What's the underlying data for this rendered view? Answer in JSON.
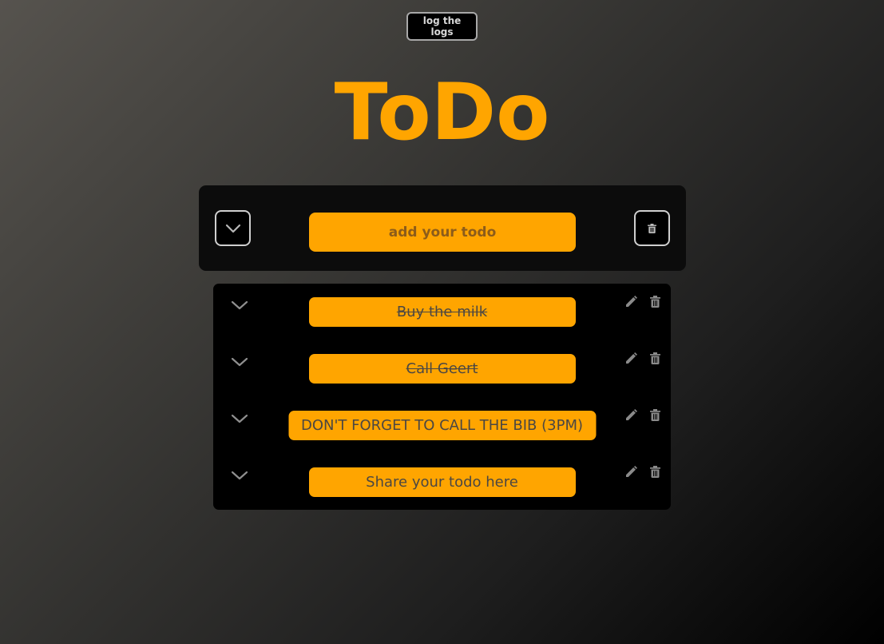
{
  "header": {
    "log_button_label": "log the logs",
    "title": "ToDo"
  },
  "add_panel": {
    "toggle_all_icon": "chevron-down-icon",
    "input_placeholder": "add your todo",
    "input_value": "",
    "clear_all_icon": "trash-icon"
  },
  "todos": [
    {
      "text": "Buy the milk",
      "completed": true
    },
    {
      "text": "Call Geert",
      "completed": true
    },
    {
      "text": "DON'T FORGET TO CALL THE BIB (3PM)",
      "completed": false
    },
    {
      "text": "Share your todo here",
      "completed": false
    }
  ],
  "icons": {
    "row_toggle": "chevron-down-icon",
    "row_edit": "pencil-icon",
    "row_delete": "trash-icon"
  },
  "colors": {
    "accent": "#ffa500",
    "panel": "#0c0c0c",
    "list_panel": "#000000",
    "pill_text": "#4b4743",
    "placeholder_text": "#8c5c1a",
    "icon_gray": "#8a8a8a"
  }
}
